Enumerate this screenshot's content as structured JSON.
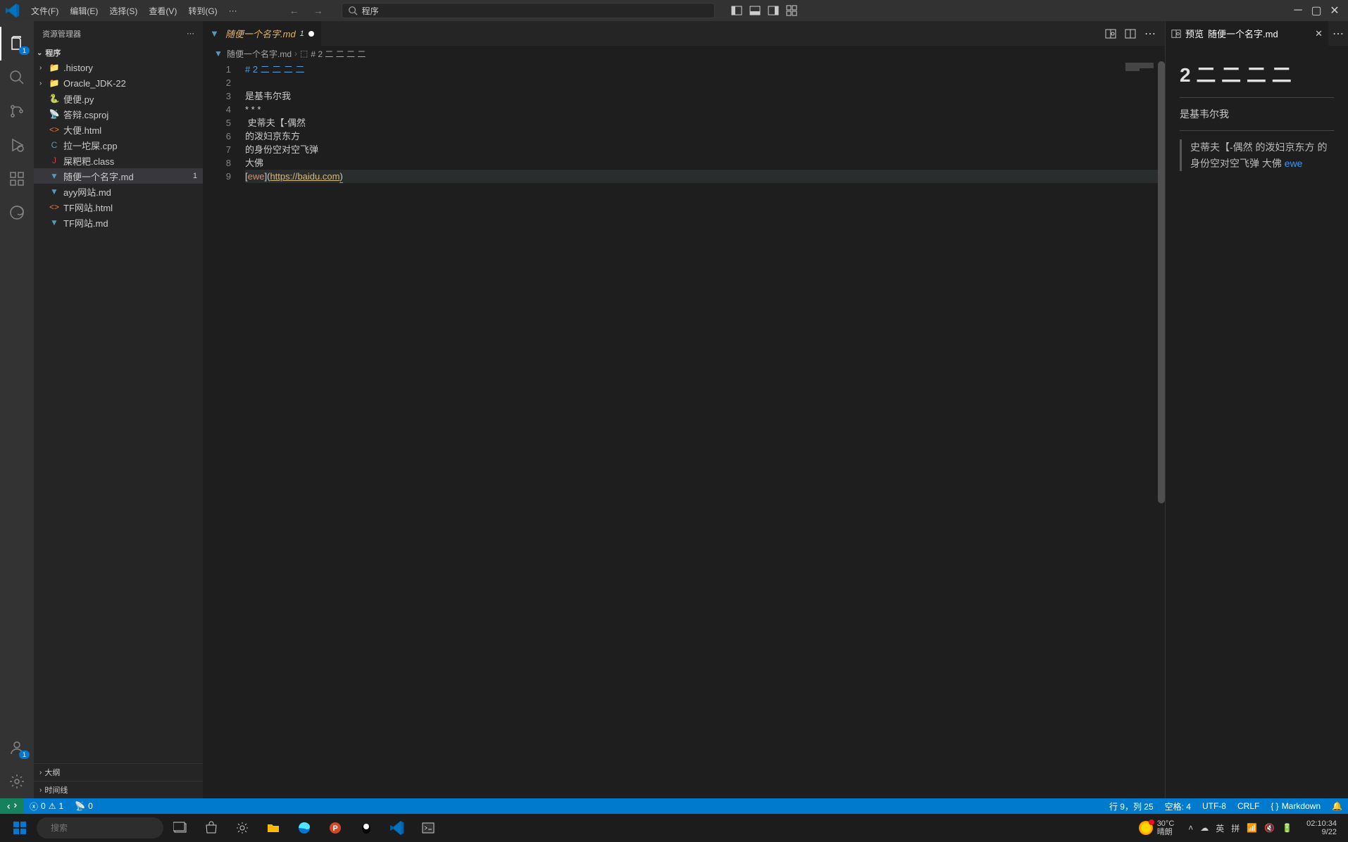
{
  "titlebar": {
    "menus": [
      "文件(F)",
      "编辑(E)",
      "选择(S)",
      "查看(V)",
      "转到(G)",
      "···"
    ],
    "search_value": "程序"
  },
  "activity_bar": {
    "explorer_badge": "1",
    "accounts_badge": "1"
  },
  "sidebar": {
    "title": "资源管理器",
    "folder": "程序",
    "items": [
      {
        "type": "folder",
        "name": ".history",
        "icon": "›"
      },
      {
        "type": "folder",
        "name": "Oracle_JDK-22",
        "icon": "›"
      },
      {
        "type": "file",
        "name": "便便.py",
        "iconClass": "ico-blue",
        "iconChar": "🐍"
      },
      {
        "type": "file",
        "name": "答辩.csproj",
        "iconClass": "ico-orange",
        "iconChar": "⚙"
      },
      {
        "type": "file",
        "name": "大便.html",
        "iconClass": "ico-orange",
        "iconChar": "<>"
      },
      {
        "type": "file",
        "name": "拉一坨屎.cpp",
        "iconClass": "ico-blue",
        "iconChar": "C"
      },
      {
        "type": "file",
        "name": "屎粑粑.class",
        "iconClass": "ico-java",
        "iconChar": "J"
      },
      {
        "type": "file",
        "name": "随便一个名字.md",
        "iconClass": "ico-blue",
        "iconChar": "▼",
        "selected": true,
        "badge": "1"
      },
      {
        "type": "file",
        "name": "ayy网站.md",
        "iconClass": "ico-blue",
        "iconChar": "▼"
      },
      {
        "type": "file",
        "name": "TF网站.html",
        "iconClass": "ico-orange",
        "iconChar": "<>"
      },
      {
        "type": "file",
        "name": "TF网站.md",
        "iconClass": "ico-blue",
        "iconChar": "▼"
      }
    ],
    "outline": "大纲",
    "timeline": "时间线"
  },
  "tabs": {
    "main": {
      "icon": "▼",
      "label": "随便一个名字.md",
      "badge": "1"
    }
  },
  "breadcrumb": {
    "file": "随便一个名字.md",
    "symbol": "# 2 二 二 二 二"
  },
  "code": {
    "lines": [
      {
        "num": "1",
        "type": "heading",
        "hash": "#",
        "rest": " 2 二 二 二 二"
      },
      {
        "num": "2",
        "type": "blank"
      },
      {
        "num": "3",
        "type": "text",
        "text": "是基韦尔我"
      },
      {
        "num": "4",
        "type": "hr",
        "text": "* * *"
      },
      {
        "num": "5",
        "type": "quote",
        "text": " 史蒂夫【-偶然"
      },
      {
        "num": "6",
        "type": "text",
        "text": "的泼妇京东方"
      },
      {
        "num": "7",
        "type": "text",
        "text": "的身份空对空飞弹"
      },
      {
        "num": "8",
        "type": "text",
        "text": "大佛"
      },
      {
        "num": "9",
        "type": "link",
        "open": "[",
        "linktext": "ewe",
        "mid": "](",
        "url": "https://baidu.com",
        "close": ")"
      }
    ]
  },
  "preview": {
    "tab_prefix": "预览",
    "tab_name": "随便一个名字.md",
    "h1": "2 二 二 二 二",
    "p1": "是基韦尔我",
    "bq": "史蒂夫【-偶然 的泼妇京东方 的身份空对空飞弹 大佛 ",
    "link": "ewe"
  },
  "status": {
    "errors": "0",
    "warnings": "1",
    "ports": "0",
    "cursor": "行 9，列 25",
    "spaces": "空格: 4",
    "encoding": "UTF-8",
    "eol": "CRLF",
    "lang": "Markdown"
  },
  "taskbar": {
    "search_placeholder": "搜索",
    "weather_temp": "30°C",
    "weather_desc": "晴朗",
    "ime1": "英",
    "ime2": "拼",
    "time": "02:10:34",
    "date": "9/22"
  }
}
